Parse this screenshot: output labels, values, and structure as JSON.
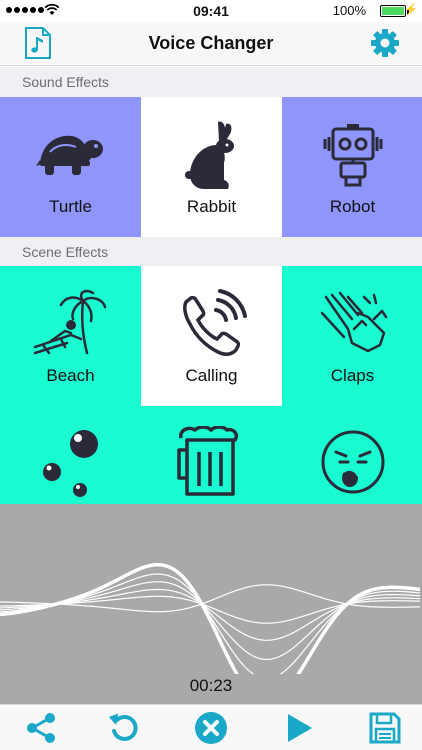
{
  "status_bar": {
    "time": "09:41",
    "battery": "100%",
    "battery_level": 1.0
  },
  "nav": {
    "title": "Voice Changer",
    "left_icon": "music-file-icon",
    "right_icon": "gear-icon"
  },
  "sections": {
    "sound": "Sound Effects",
    "scene": "Scene Effects"
  },
  "sound_effects": [
    {
      "label": "Turtle",
      "icon": "turtle-icon",
      "selected": false
    },
    {
      "label": "Rabbit",
      "icon": "rabbit-icon",
      "selected": true
    },
    {
      "label": "Robot",
      "icon": "robot-icon",
      "selected": false
    }
  ],
  "scene_effects": [
    {
      "label": "Beach",
      "icon": "beach-icon",
      "selected": false
    },
    {
      "label": "Calling",
      "icon": "phone-icon",
      "selected": true
    },
    {
      "label": "Claps",
      "icon": "clapping-hands-icon",
      "selected": false
    },
    {
      "icon": "bubbles-icon"
    },
    {
      "icon": "beer-mug-icon"
    },
    {
      "icon": "sick-face-icon"
    }
  ],
  "player": {
    "timer": "00:23"
  },
  "toolbar": {
    "items": [
      "share-icon",
      "undo-icon",
      "cancel-icon",
      "play-icon",
      "save-icon"
    ]
  },
  "colors": {
    "accent": "#1aa8c8",
    "sound_bg": "#8f95fb",
    "scene_bg": "#19fbd0",
    "selected_bg": "#ffffff",
    "wave_bg": "#a9a9a9",
    "icon_dark": "#2a2a38"
  }
}
